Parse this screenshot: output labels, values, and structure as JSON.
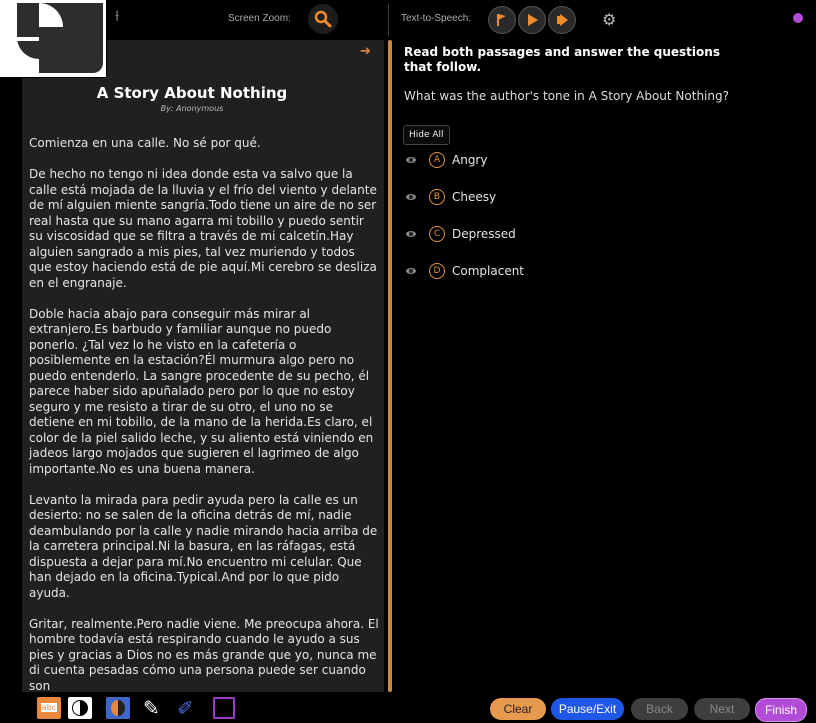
{
  "toolbar": {
    "zoom_label": "Screen Zoom:",
    "tts_label": "Text-to-Speech:",
    "icons": [
      "search-icon",
      "flag-icon",
      "play-icon",
      "fast-forward-icon",
      "gear-icon"
    ],
    "accent": "#e0943e"
  },
  "passage": {
    "title": "A Story About Nothing",
    "author": "By: Anonymous",
    "paragraphs": [
      "Comienza en una calle. No sé por qué.",
      "De hecho no tengo ni idea donde esta va salvo que la calle está mojada de la lluvia y el frío del viento y delante de mí alguien miente sangría.Todo tiene un aire de no ser real hasta que su mano agarra mi tobillo y puedo sentir su viscosidad que se filtra a través de mi calcetín.Hay alguien sangrado a mis pies, tal vez muriendo y todos que estoy haciendo está de pie aquí.Mi cerebro se desliza en el engranaje.",
      "Doble hacia abajo para conseguir más mirar al extranjero.Es barbudo y familiar aunque no puedo ponerlo. ¿Tal vez lo he visto en la cafetería o posiblemente en la estación?Él murmura algo pero no puedo entenderlo. La sangre procedente de su pecho, él parece haber sido apuñalado pero por lo que no estoy seguro y me resisto a tirar de su otro, el uno no se detiene en mi tobillo, de la mano de la herida.Es claro, el color de la piel salido leche, y su aliento está viniendo en jadeos largo mojados que sugieren el lagrimeo de algo importante.No es una buena manera.",
      "Levanto la mirada para pedir ayuda pero la calle es un desierto: no se salen de la oficina detrás de mí, nadie deambulando por la calle y nadie mirando hacia arriba de la carretera principal.Ni la basura, en las ráfagas, está dispuesta a dejar para mí.No encuentro mi celular. Que han dejado en la oficina.Typical.And por lo que pido ayuda.",
      "Gritar, realmente.Pero nadie viene. Me preocupa ahora. El hombre todavía está respirando cuando le ayudo a sus pies y gracias a Dios no es más grande que yo, nunca me di cuenta pesadas cómo una persona puede ser cuando son"
    ]
  },
  "question": {
    "instructions": "Read both passages and answer the questions that follow.",
    "prompt": "What was the author's tone in A Story About Nothing?",
    "hide_all": "Hide All",
    "answers": [
      {
        "letter": "A",
        "text": "Angry"
      },
      {
        "letter": "B",
        "text": "Cheesy"
      },
      {
        "letter": "C",
        "text": "Depressed"
      },
      {
        "letter": "D",
        "text": "Complacent"
      }
    ]
  },
  "bottom": {
    "tools": [
      "abc-masking-tool",
      "contrast-icon",
      "color-contrast-icon",
      "pencil-icon",
      "highlighter-icon",
      "notepad-icon"
    ],
    "abc_label": "abc",
    "clear": "Clear",
    "pause_exit": "Pause/Exit",
    "back": "Back",
    "next": "Next",
    "finish": "Finish"
  }
}
